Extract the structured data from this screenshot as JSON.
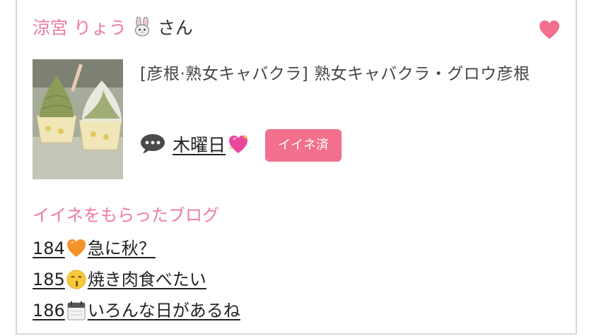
{
  "user": {
    "name": "涼宮 りょう",
    "name_emoji": "rabbit-face",
    "suffix": "さん"
  },
  "favorite": {
    "icon": "heart-icon",
    "color": "#f26f8e"
  },
  "thumbnail": {
    "alt_icon": "soft-serve-ice-cream-photo"
  },
  "shop": {
    "title": "[彦根·熟女キャバクラ]  熟女キャバクラ・グロウ彦根"
  },
  "comment": {
    "icon": "speech-bubble-icon",
    "text": "木曜日",
    "emoji": "sparkling-heart"
  },
  "like_button": {
    "label": "イイネ済",
    "color": "#f26f8e"
  },
  "blogs": {
    "heading": "イイネをもらったブログ",
    "items": [
      {
        "number": "184",
        "emoji": "orange-heart",
        "title": "急に秋？"
      },
      {
        "number": "185",
        "emoji": "kissing-face",
        "title": "焼き肉食べたい"
      },
      {
        "number": "186",
        "emoji": "calendar",
        "title": "いろんな日があるね"
      }
    ]
  },
  "colors": {
    "accent_pink": "#ec7c9c",
    "button_pink": "#f26f8e",
    "border": "#d9d9d9"
  }
}
